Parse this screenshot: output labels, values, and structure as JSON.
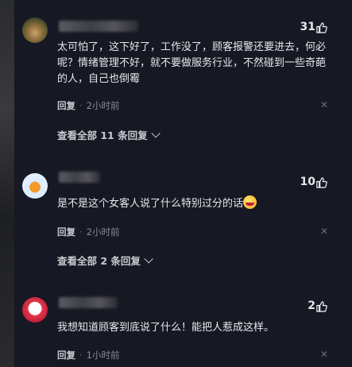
{
  "comments": [
    {
      "likes": "31",
      "text": "太可怕了，这下好了，工作没了，顾客报警还要进去，何必呢？情绪管理不好，就不要做服务行业，不然碰到一些奇葩的人，自己也倒霉",
      "reply_label": "回复",
      "time": "2小时前",
      "view_replies": "查看全部 11 条回复"
    },
    {
      "likes": "10",
      "text": "是不是这个女客人说了什么特别过分的话",
      "reply_label": "回复",
      "time": "2小时前",
      "view_replies": "查看全部 2 条回复"
    },
    {
      "likes": "2",
      "text": "我想知道顾客到底说了什么！能把人惹成这样。",
      "reply_label": "回复",
      "time": "1小时前"
    }
  ],
  "colors": {
    "background": "#161823",
    "text": "#e8e8ea",
    "muted": "#8a8b92"
  },
  "icons": [
    "thumbs-up-icon",
    "close-icon",
    "chevron-down-icon",
    "laughing-emoji-icon"
  ]
}
